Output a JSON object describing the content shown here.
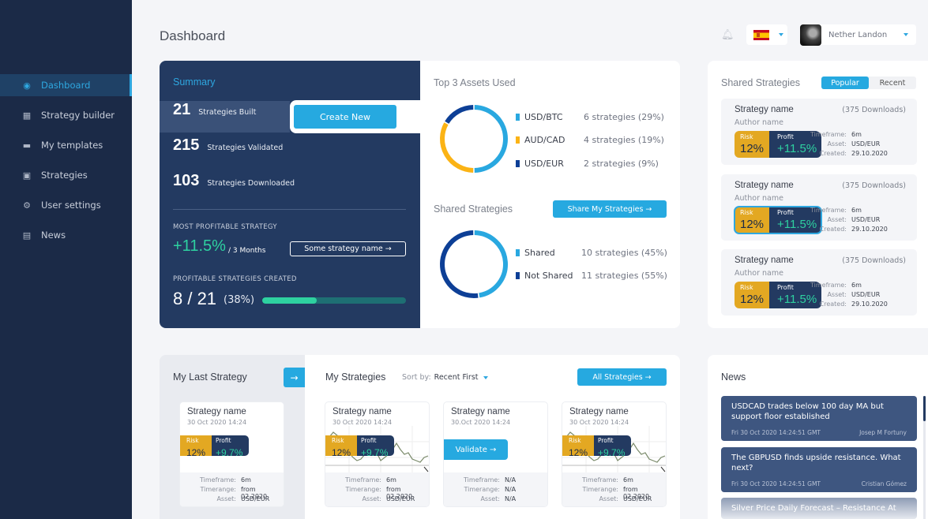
{
  "sidebar": {
    "items": [
      {
        "label": "Dashboard",
        "icon": "dashboard-icon",
        "active": true
      },
      {
        "label": "Strategy builder",
        "icon": "builder-icon"
      },
      {
        "label": "My templates",
        "icon": "folder-icon"
      },
      {
        "label": "Strategies",
        "icon": "monitor-icon"
      },
      {
        "label": "User settings",
        "icon": "gear-icon"
      },
      {
        "label": "News",
        "icon": "news-icon"
      }
    ]
  },
  "header": {
    "title": "Dashboard",
    "language": "Spanish",
    "user_name": "Nether Landon"
  },
  "summary": {
    "title": "Summary",
    "stats": [
      {
        "value": "21",
        "label": "Strategies Built"
      },
      {
        "value": "215",
        "label": "Strategies Validated"
      },
      {
        "value": "103",
        "label": "Strategies Downloaded"
      }
    ],
    "create_button": "Create New",
    "most_profitable_label": "MOST PROFITABLE STRATEGY",
    "most_profitable_value": "+11.5%",
    "most_profitable_period": "/ 3 Months",
    "strategy_link": "Some strategy name →",
    "profitable_label": "PROFITABLE STRATEGIES CREATED",
    "profitable_ratio": "8 / 21",
    "profitable_pct": "(38%)",
    "profitable_fraction": 0.38
  },
  "top_assets": {
    "title": "Top 3 Assets Used",
    "items": [
      {
        "name": "USD/BTC",
        "value": "6 strategies  (29%)",
        "count": 6,
        "color": "#29a8e0"
      },
      {
        "name": "AUD/CAD",
        "value": "4 strategies  (19%)",
        "count": 4,
        "color": "#fbb315"
      },
      {
        "name": "USD/EUR",
        "value": "2 strategies  (9%)",
        "count": 2,
        "color": "#0d3f96"
      }
    ]
  },
  "shared": {
    "title": "Shared Strategies",
    "button": "Share My Strategies →",
    "items": [
      {
        "name": "Shared",
        "value": "10 strategies  (45%)",
        "count": 10,
        "color": "#29a8e0"
      },
      {
        "name": "Not Shared",
        "value": "11 strategies  (55%)",
        "count": 11,
        "color": "#0d3f96"
      }
    ]
  },
  "shared_panel": {
    "title": "Shared Strategies",
    "tabs": [
      "Popular",
      "Recent"
    ],
    "cards": [
      {
        "name": "Strategy name",
        "downloads": "(375 Downloads)",
        "author": "Author name",
        "risk_label": "Risk",
        "risk": "12%",
        "profit_label": "Profit",
        "profit": "+11.5%",
        "timeframe": "6m",
        "asset": "USD/EUR",
        "created": "29.10.2020"
      },
      {
        "name": "Strategy name",
        "downloads": "(375 Downloads)",
        "author": "Author name",
        "risk_label": "Risk",
        "risk": "12%",
        "profit_label": "Profit",
        "profit": "+11.5%",
        "timeframe": "6m",
        "asset": "USD/EUR",
        "created": "29.10.2020"
      },
      {
        "name": "Strategy name",
        "downloads": "(375 Downloads)",
        "author": "Author name",
        "risk_label": "Risk",
        "risk": "12%",
        "profit_label": "Profit",
        "profit": "+11.5%",
        "timeframe": "6m",
        "asset": "USD/EUR",
        "created": "29.10.2020"
      }
    ],
    "meta_labels": {
      "timeframe": "Timeframe:",
      "asset": "Asset:",
      "created": "Created:"
    }
  },
  "last_strategy": {
    "title": "My Last Strategy",
    "card": {
      "name": "Strategy name",
      "date": "30 Oct 2020 14:24",
      "risk_label": "Risk",
      "risk": "12%",
      "profit_label": "Profit",
      "profit": "+9.7%",
      "timeframe": "6m",
      "timerange": "from 02.2020",
      "asset": "USD/EUR"
    }
  },
  "my_strategies": {
    "title": "My Strategies",
    "sort_label": "Sort by:",
    "sort_value": "Recent First",
    "all_button": "All Strategies →",
    "validate_button": "Validate →",
    "foot_labels": {
      "timeframe": "Timeframe:",
      "timerange": "Timerange:",
      "asset": "Asset:"
    },
    "cards": [
      {
        "name": "Strategy name",
        "date": "30 Oct 2020 14:24",
        "risk_label": "Risk",
        "risk": "12%",
        "profit_label": "Profit",
        "profit": "+9.7%",
        "timeframe": "6m",
        "timerange": "from 02.2020",
        "asset": "USD/EUR"
      },
      {
        "name": "Strategy name",
        "date": "30.Oct 2020 14:24",
        "timeframe": "N/A",
        "timerange": "N/A",
        "asset": "N/A"
      },
      {
        "name": "Strategy name",
        "date": "30 Oct 2020 14:24",
        "risk_label": "Risk",
        "risk": "12%",
        "profit_label": "Profit",
        "profit": "+9.7%",
        "timeframe": "6m",
        "timerange": "from 02.2020",
        "asset": "USD/EUR"
      }
    ]
  },
  "news": {
    "title": "News",
    "items": [
      {
        "title": "USDCAD trades below 100 day MA but support floor established",
        "date": "Fri 30 Oct 2020 14:24:51 GMT",
        "author": "Josep M Fortuny"
      },
      {
        "title": "The GBPUSD finds upside resistance. What next?",
        "date": "Fri 30 Oct 2020 14:24:51 GMT",
        "author": "Cristian Gómez"
      },
      {
        "title": "Silver Price Daily Forecast – Resistance At",
        "date": "",
        "author": ""
      }
    ]
  }
}
